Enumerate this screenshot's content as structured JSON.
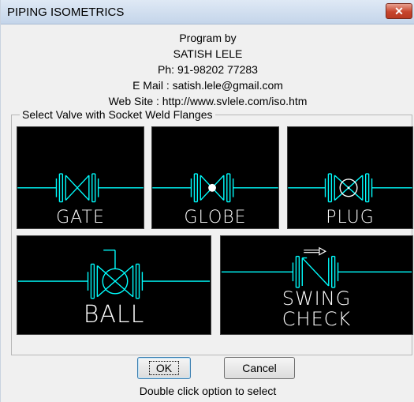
{
  "window": {
    "title": "PIPING ISOMETRICS",
    "close_glyph": "✕"
  },
  "info": {
    "line1": "Program by",
    "line2": "SATISH LELE",
    "line3": "Ph: 91-98202 77283",
    "line4": "E Mail : satish.lele@gmail.com",
    "line5": "Web Site : http://www.svlele.com/iso.htm"
  },
  "group": {
    "label": "Select Valve with Socket Weld Flanges"
  },
  "valves": [
    {
      "label": "GATE"
    },
    {
      "label": "GLOBE"
    },
    {
      "label": "PLUG"
    },
    {
      "label": "BALL"
    },
    {
      "label1": "SWING",
      "label2": "CHECK"
    }
  ],
  "buttons": {
    "ok": "OK",
    "cancel": "Cancel"
  },
  "hint": "Double click option to select",
  "colors": {
    "pipe": "#00ffff",
    "symbol_bg": "#000000",
    "label": "#ffffff"
  }
}
